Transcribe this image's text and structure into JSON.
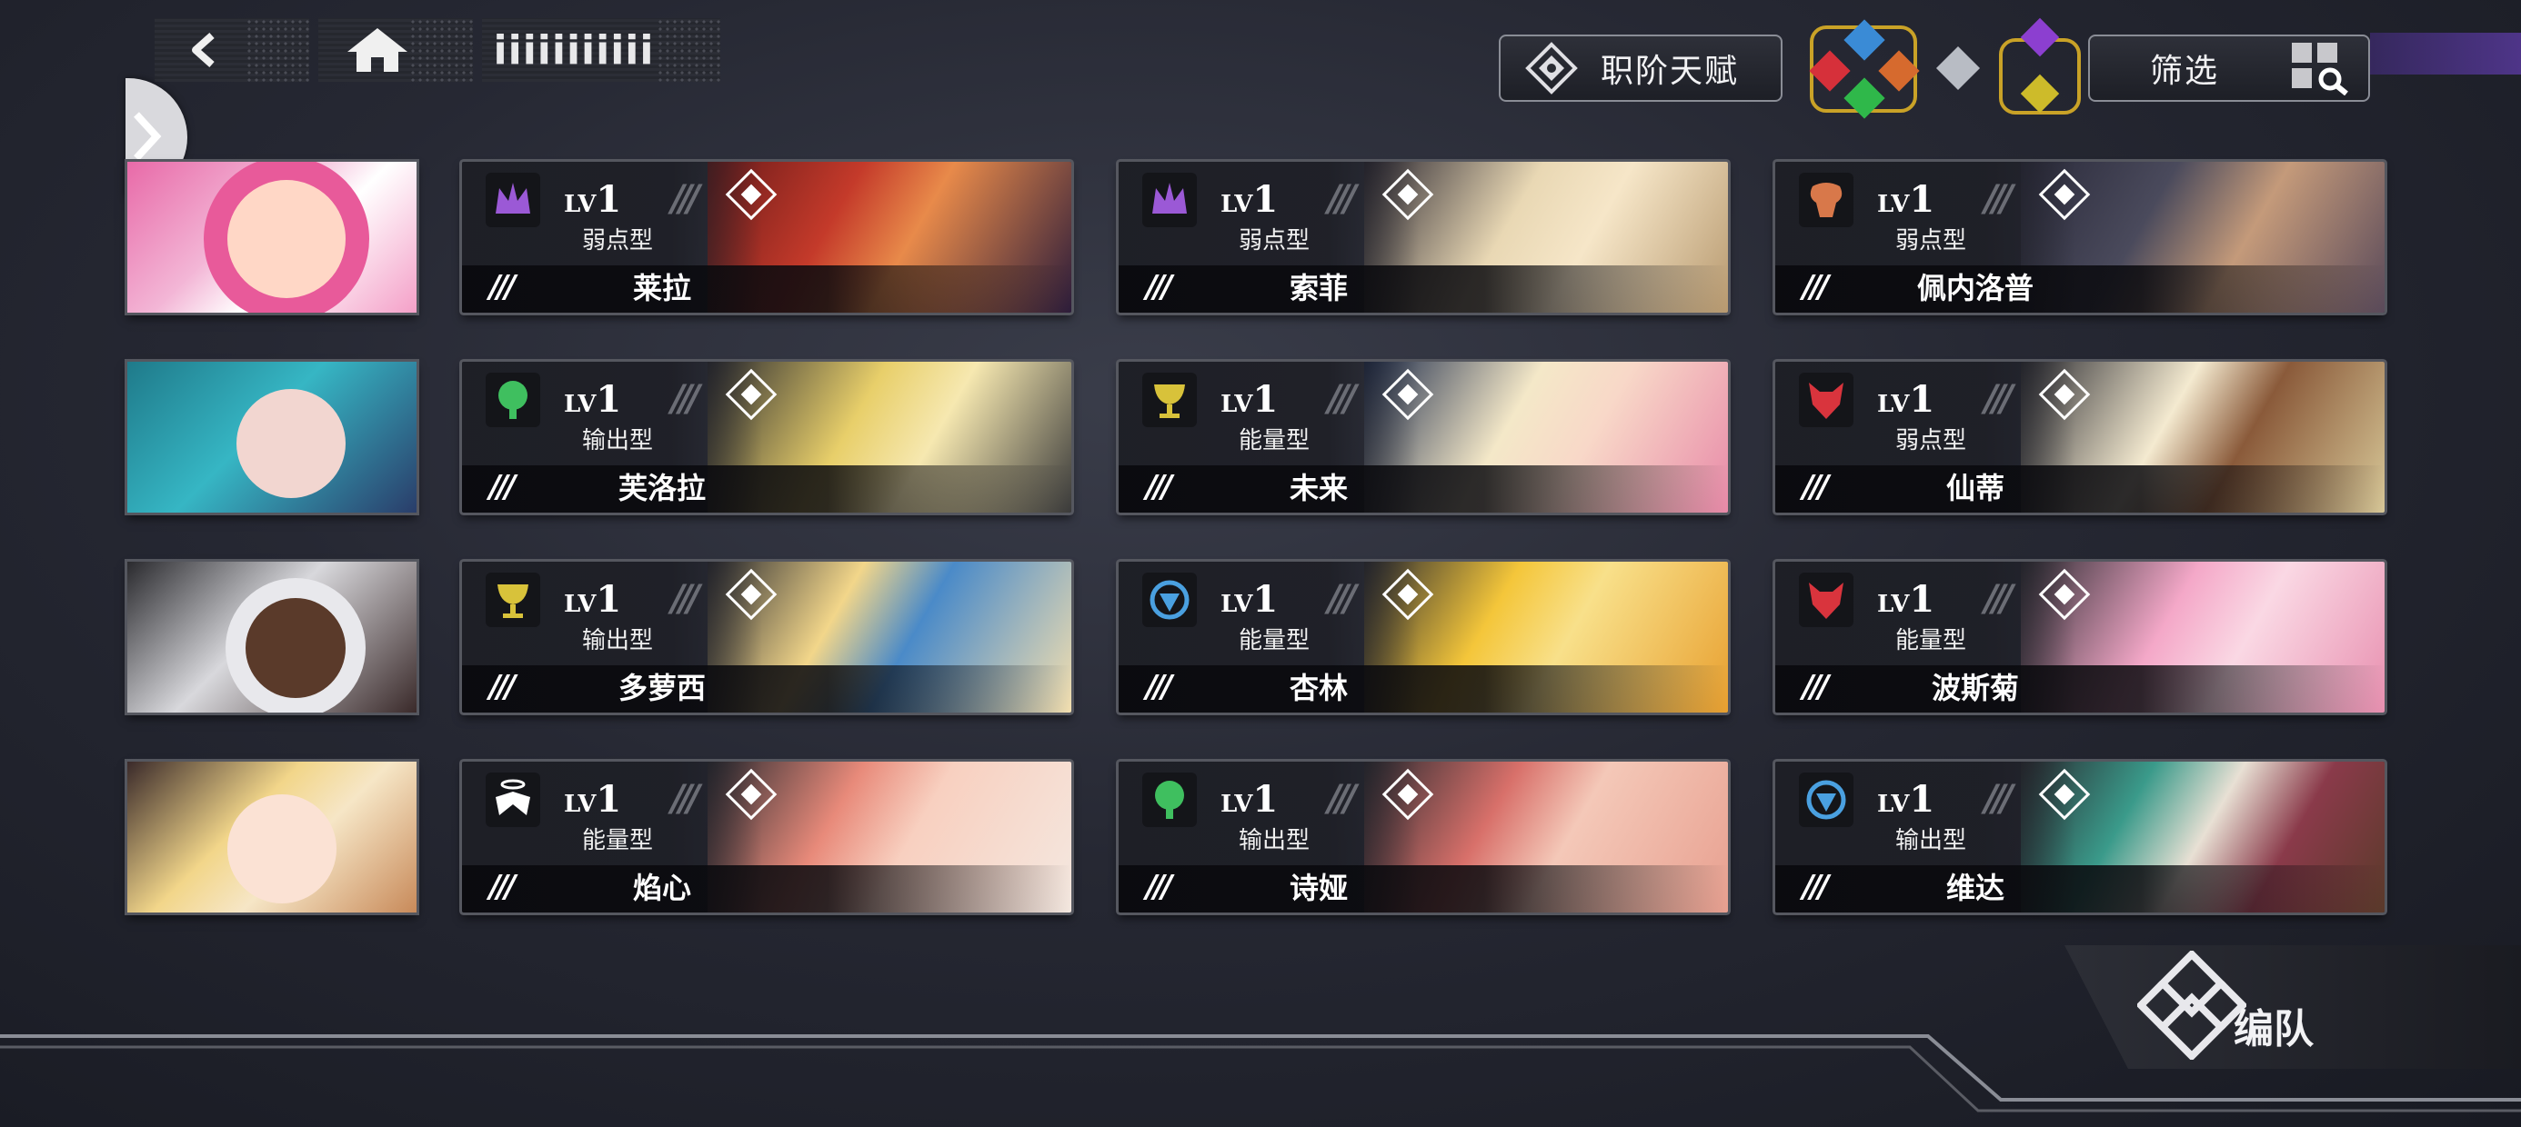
{
  "nav": {
    "back_icon": "back-arrow-icon",
    "home_icon": "home-icon",
    "title": "iiiiiiiiiii"
  },
  "buttons": {
    "talent_label": "职阶天赋",
    "filter_label": "筛选",
    "formation_label": "编队"
  },
  "cards": [
    {
      "lv": "LV",
      "lv_num": "1",
      "type": "弱点型",
      "name": "莱拉",
      "emblem": "crown-icon",
      "emblem_color": "#9b59d6"
    },
    {
      "lv": "LV",
      "lv_num": "1",
      "type": "弱点型",
      "name": "索菲",
      "emblem": "crown-icon",
      "emblem_color": "#9b59d6"
    },
    {
      "lv": "LV",
      "lv_num": "1",
      "type": "弱点型",
      "name": "佩内洛普",
      "emblem": "ram-icon",
      "emblem_color": "#d8784a"
    },
    {
      "lv": "LV",
      "lv_num": "1",
      "type": "输出型",
      "name": "芙洛拉",
      "emblem": "tree-icon",
      "emblem_color": "#3fbf5f"
    },
    {
      "lv": "LV",
      "lv_num": "1",
      "type": "能量型",
      "name": "未来",
      "emblem": "chalice-icon",
      "emblem_color": "#d8c23a"
    },
    {
      "lv": "LV",
      "lv_num": "1",
      "type": "弱点型",
      "name": "仙蒂",
      "emblem": "wolf-icon",
      "emblem_color": "#d9343d"
    },
    {
      "lv": "LV",
      "lv_num": "1",
      "type": "输出型",
      "name": "多萝西",
      "emblem": "chalice-icon",
      "emblem_color": "#d8c23a"
    },
    {
      "lv": "LV",
      "lv_num": "1",
      "type": "能量型",
      "name": "杏林",
      "emblem": "shield-icon",
      "emblem_color": "#4aa0e0"
    },
    {
      "lv": "LV",
      "lv_num": "1",
      "type": "能量型",
      "name": "波斯菊",
      "emblem": "wolf-icon",
      "emblem_color": "#d9343d"
    },
    {
      "lv": "LV",
      "lv_num": "1",
      "type": "能量型",
      "name": "焰心",
      "emblem": "wings-icon",
      "emblem_color": "#ffffff"
    },
    {
      "lv": "LV",
      "lv_num": "1",
      "type": "输出型",
      "name": "诗娅",
      "emblem": "tree-icon",
      "emblem_color": "#3fbf5f"
    },
    {
      "lv": "LV",
      "lv_num": "1",
      "type": "输出型",
      "name": "维达",
      "emblem": "shield-icon",
      "emblem_color": "#4aa0e0"
    }
  ],
  "stars_glyph": "///",
  "slash_glyph": "///"
}
